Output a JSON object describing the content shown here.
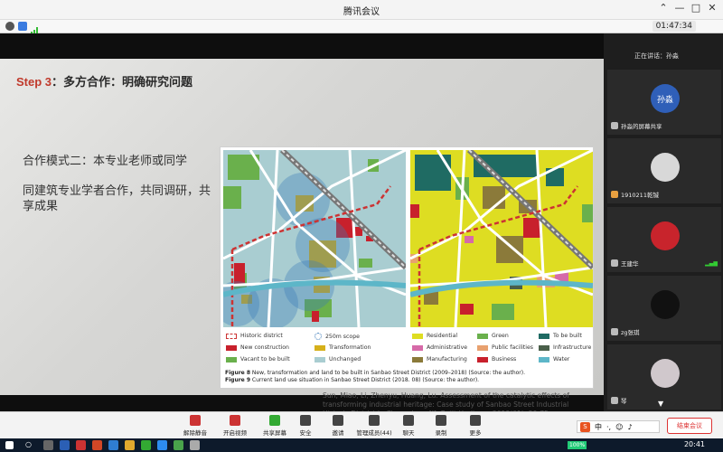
{
  "window": {
    "title": "腾讯会议",
    "timer": "01:47:34",
    "controls": [
      "—",
      "□",
      "✕"
    ]
  },
  "slide": {
    "step_label": "Step 3",
    "step_text": "：多方合作：明确研究问题",
    "mode_line": "合作模式二：本专业老师或同学",
    "desc_line": "同建筑专业学者合作，共同调研，共享成果",
    "figure": {
      "legend_left": [
        {
          "label": "Historic district",
          "color": "#ffffff",
          "border": "#c33"
        },
        {
          "label": "250m scope",
          "color": "#ffffff",
          "border": "#3a7ab8"
        },
        {
          "label": "New construction",
          "color": "#c8202c"
        },
        {
          "label": "Transformation",
          "color": "#d6b01a"
        },
        {
          "label": "Vacant to be built",
          "color": "#6ab04c"
        },
        {
          "label": "Unchanged",
          "color": "#a9cdd1"
        }
      ],
      "legend_right": [
        {
          "label": "Residential",
          "color": "#dedd22"
        },
        {
          "label": "Green",
          "color": "#6ab04c"
        },
        {
          "label": "To be built",
          "color": "#1f6b63"
        },
        {
          "label": "Administrative",
          "color": "#d66aa8"
        },
        {
          "label": "Public facilities",
          "color": "#e8a16f"
        },
        {
          "label": "Infrastructure",
          "color": "#4a5f4a"
        },
        {
          "label": "Manufacturing",
          "color": "#8b7a3a"
        },
        {
          "label": "Business",
          "color": "#c8202c"
        },
        {
          "label": "Water",
          "color": "#5db6c8"
        }
      ],
      "caption_fig8_label": "Figure 8",
      "caption_fig8_text": " New, transformation and land to be built in Sanbao Street District (2009–2018) (Source: the author).",
      "caption_fig9_label": "Figure 9",
      "caption_fig9_text": " Current land use situation in Sanbao Street District (2018. 08) (Source: the author)."
    },
    "citation": "Sun, Miao, Li, Zhenyu, Huang, Lu. Assessment of the catalytic effects of transforming industrial heritage: Case study of Sanbao Street Industrial Historic District in Changzhou. [J]. Built Heritage, 2019(01): 59-75."
  },
  "participants": {
    "speaking_label": "正在讲话：孙淼",
    "tiles": [
      {
        "name": "孙淼的屏幕共享",
        "avatar_text": "孙淼",
        "avatar_color": "#2f5fb8"
      },
      {
        "name": "1910211乾铖",
        "avatar_text": "",
        "avatar_color": "#d8d8d8"
      },
      {
        "name": "王建华",
        "avatar_text": "",
        "avatar_color": "#c8242c"
      },
      {
        "name": "zg张琪",
        "avatar_text": "",
        "avatar_color": "#111111"
      },
      {
        "name": "琴",
        "avatar_text": "",
        "avatar_color": "#d0c8cc"
      }
    ]
  },
  "toolbar": {
    "mute": "解除静音",
    "video": "开启视频",
    "share": "共享屏幕",
    "security": "安全",
    "invite": "邀请",
    "members": "管理成员(44)",
    "chat": "聊天",
    "record": "录制",
    "more": "更多",
    "end": "结束会议"
  },
  "ime": {
    "s": "S",
    "mode": "中"
  },
  "taskbar": {
    "battery": "100%",
    "clock": "20:41"
  }
}
